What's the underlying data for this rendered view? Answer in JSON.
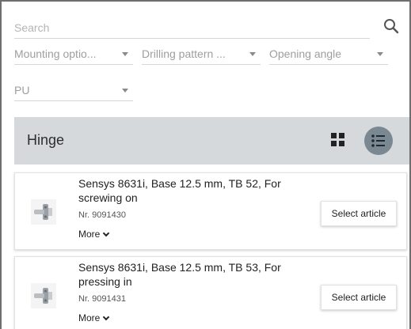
{
  "search": {
    "placeholder": "Search"
  },
  "filters": [
    {
      "label": "Mounting optio..."
    },
    {
      "label": "Drilling pattern ..."
    },
    {
      "label": "Opening angle"
    },
    {
      "label": "PU"
    }
  ],
  "section": {
    "title": "Hinge",
    "active_view": "list"
  },
  "articles": [
    {
      "title": "Sensys 8631i, Base 12.5 mm, TB 52, For screwing on",
      "number": "Nr. 9091430",
      "more_label": "More",
      "button_label": "Select article"
    },
    {
      "title": "Sensys 8631i, Base 12.5 mm, TB 53, For pressing in",
      "number": "Nr. 9091431",
      "more_label": "More",
      "button_label": "Select article"
    }
  ],
  "colors": {
    "header_background": "#d5d9dc",
    "active_view_button": "#7b8791",
    "divider": "#d6d6d6"
  },
  "icons": [
    "search-icon",
    "grid-view-icon",
    "list-view-icon",
    "hinge-thumbnail",
    "chevron-down-icon"
  ]
}
